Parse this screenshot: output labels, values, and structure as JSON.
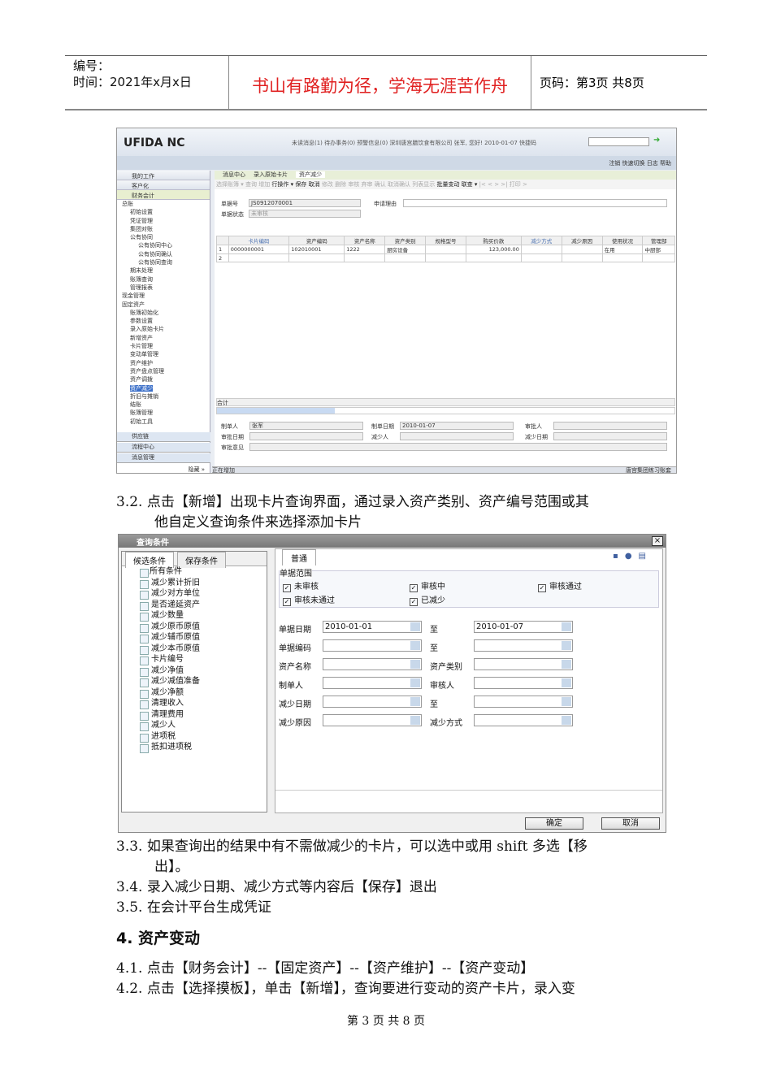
{
  "header": {
    "number_label": "编号：",
    "date_label": "时间：2021年x月x日",
    "motto": "书山有路勤为径，学海无涯苦作舟",
    "page_info": "页码：第3页  共8页"
  },
  "screenshot1": {
    "logo": "UFIDA NC",
    "info": "未读消息(1)  待办事务(0)  预警信息(0)  深圳唐宫膳饮食有限公司 张军, 您好! 2010-01-07   快捷码",
    "top_links": "注销  快速切换  日志  帮助",
    "sidebar_heads": [
      "我的工作",
      "客户化",
      "财务会计"
    ],
    "tree": [
      "总账",
      "初始设置",
      "凭证管理",
      "集团对账",
      "公有协同",
      "公有协同中心",
      "公有协同确认",
      "公有协同查询",
      "期末处理",
      "账簿查询",
      "管理报表",
      "现金管理",
      "固定资产",
      "账簿初始化",
      "参数设置",
      "录入原始卡片",
      "新增资产",
      "卡片管理",
      "变动单管理",
      "资产维护",
      "资产盘点管理",
      "资产调拨",
      "资产减少",
      "折旧与摊销",
      "结账",
      "账簿管理",
      "初始工具"
    ],
    "sidebar_foot": [
      "供应链",
      "流程中心",
      "消息管理"
    ],
    "hide": "隐藏 »",
    "tabs": [
      "消息中心",
      "录入原始卡片",
      "资产减少"
    ],
    "toolbar": "选择账簿 ▾  查询  增加  ",
    "toolbar_active": [
      "行操作 ▾",
      "保存",
      "取消"
    ],
    "toolbar_rest": "  修改  删除  审核  弃审  确认  取消确认  列表显示  ",
    "toolbar_active2": [
      "批量变动",
      "联查 ▾"
    ],
    "toolbar_end": "  |<  <  >  >|  打印  >",
    "bill_no_label": "单据号",
    "bill_no": "JS0912070001",
    "status_label": "单据状态",
    "status": "未审核",
    "reason_label": "申请理由",
    "columns": [
      "",
      "卡片编码",
      "资产编码",
      "资产名称",
      "资产类别",
      "规格型号",
      "购买价款",
      "减少方式",
      "减少原因",
      "使用状况",
      "管理部"
    ],
    "rows": [
      [
        "1",
        "0000000001",
        "102010001",
        "1222",
        "厨房设备",
        "",
        "123,000.00",
        "",
        "",
        "在用",
        "中厨部"
      ],
      [
        "2",
        "",
        "",
        "",
        "",
        "",
        "",
        "",
        "",
        "",
        ""
      ]
    ],
    "total_label": "合计",
    "footer_fields": [
      [
        "制单人",
        "张军"
      ],
      [
        "制单日期",
        "2010-01-07"
      ],
      [
        "审批人",
        ""
      ],
      [
        "审批日期",
        ""
      ],
      [
        "减少人",
        ""
      ],
      [
        "减少日期",
        ""
      ],
      [
        "审批意见",
        ""
      ]
    ],
    "status_left": "正在增加",
    "status_right": "唐宫集团练习账套"
  },
  "step_3_2": "3.2. 点击【新增】出现卡片查询界面，通过录入资产类别、资产编号范围或其",
  "step_3_2b": "他自定义查询条件来选择添加卡片",
  "screenshot2": {
    "title": "查询条件",
    "close": "×",
    "left_tabs": [
      "候选条件",
      "保存条件"
    ],
    "root": "所有条件",
    "conditions": [
      "减少累计折旧",
      "减少对方单位",
      "是否递延资产",
      "减少数量",
      "减少原币原值",
      "减少辅币原值",
      "减少本币原值",
      "卡片编号",
      "减少净值",
      "减少减值准备",
      "减少净额",
      "清理收入",
      "清理费用",
      "减少人",
      "进项税",
      "抵扣进项税"
    ],
    "tab": "普通",
    "range_label": "单据范围",
    "checks": [
      "未审核",
      "审核中",
      "审核通过",
      "审核未通过",
      "已减少"
    ],
    "fields": [
      [
        "单据日期",
        "2010-01-01",
        "至",
        "2010-01-07"
      ],
      [
        "单据编码",
        "",
        "至",
        ""
      ],
      [
        "资产名称",
        "",
        "资产类别",
        ""
      ],
      [
        "制单人",
        "",
        "审核人",
        ""
      ],
      [
        "减少日期",
        "",
        "至",
        ""
      ],
      [
        "减少原因",
        "",
        "减少方式",
        ""
      ]
    ],
    "ok": "确定",
    "cancel": "取消"
  },
  "step_3_3": "3.3. 如果查询出的结果中有不需做减少的卡片，可以选中或用 shift 多选【移",
  "step_3_3b": "出】。",
  "step_3_4": "3.4. 录入减少日期、减少方式等内容后【保存】退出",
  "step_3_5": "3.5. 在会计平台生成凭证",
  "section4": "4.  资产变动",
  "step_4_1": "4.1. 点击【财务会计】--【固定资产】--【资产维护】--【资产变动】",
  "step_4_2": "4.2. 点击【选择摸板】，单击【新增】，查询要进行变动的资产卡片，录入变",
  "footer": "第 3 页 共 8 页"
}
